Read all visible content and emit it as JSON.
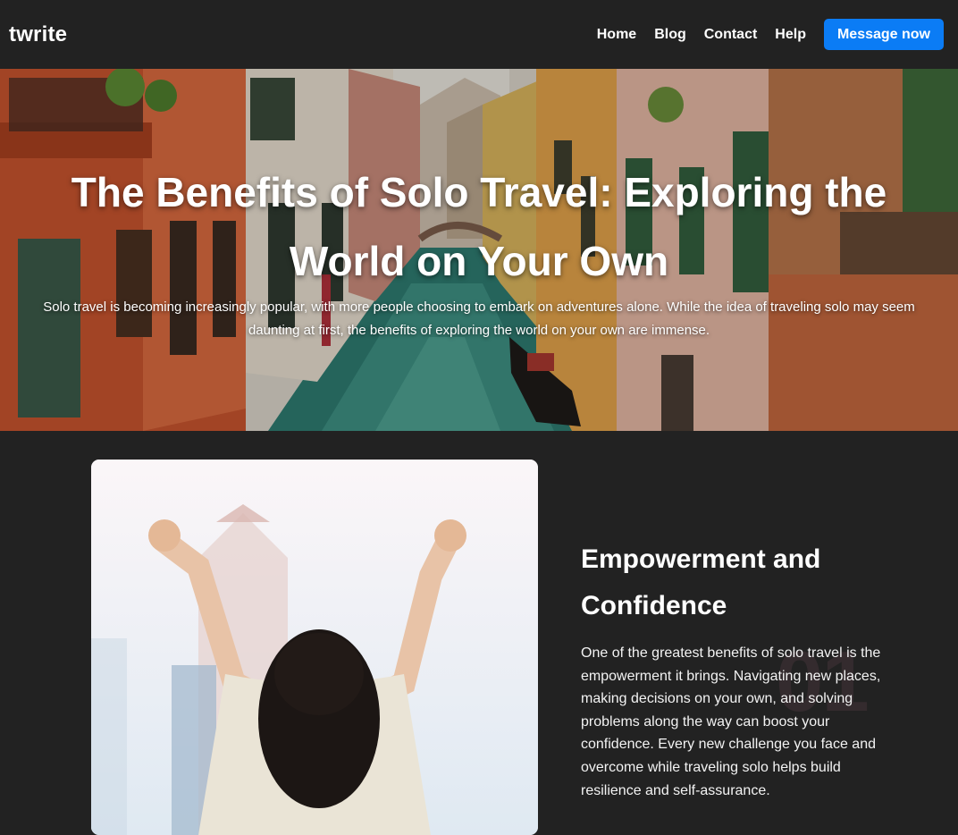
{
  "header": {
    "brand": "twrite",
    "nav": [
      {
        "label": "Home"
      },
      {
        "label": "Blog"
      },
      {
        "label": "Contact"
      },
      {
        "label": "Help"
      }
    ],
    "cta_label": "Message now",
    "cta_color": "#0b7cf5"
  },
  "hero": {
    "title": "The Benefits of Solo Travel: Exploring the World on Your Own",
    "subtitle": "Solo travel is becoming increasingly popular, with more people choosing to embark on adventures alone. While the idea of traveling solo may seem daunting at first, the benefits of exploring the world on your own are immense.",
    "image": "venice-canal-photo"
  },
  "feature": {
    "number": "01",
    "title": "Empowerment and Confidence",
    "text": "One of the greatest benefits of solo travel is the empowerment it brings. Navigating new places, making decisions on your own, and solving problems along the way can boost your confidence. Every new challenge you face and overcome while traveling solo helps build resilience and self-assurance.",
    "image": "woman-arms-raised-photo"
  },
  "colors": {
    "background": "#222222",
    "text": "#ffffff"
  }
}
